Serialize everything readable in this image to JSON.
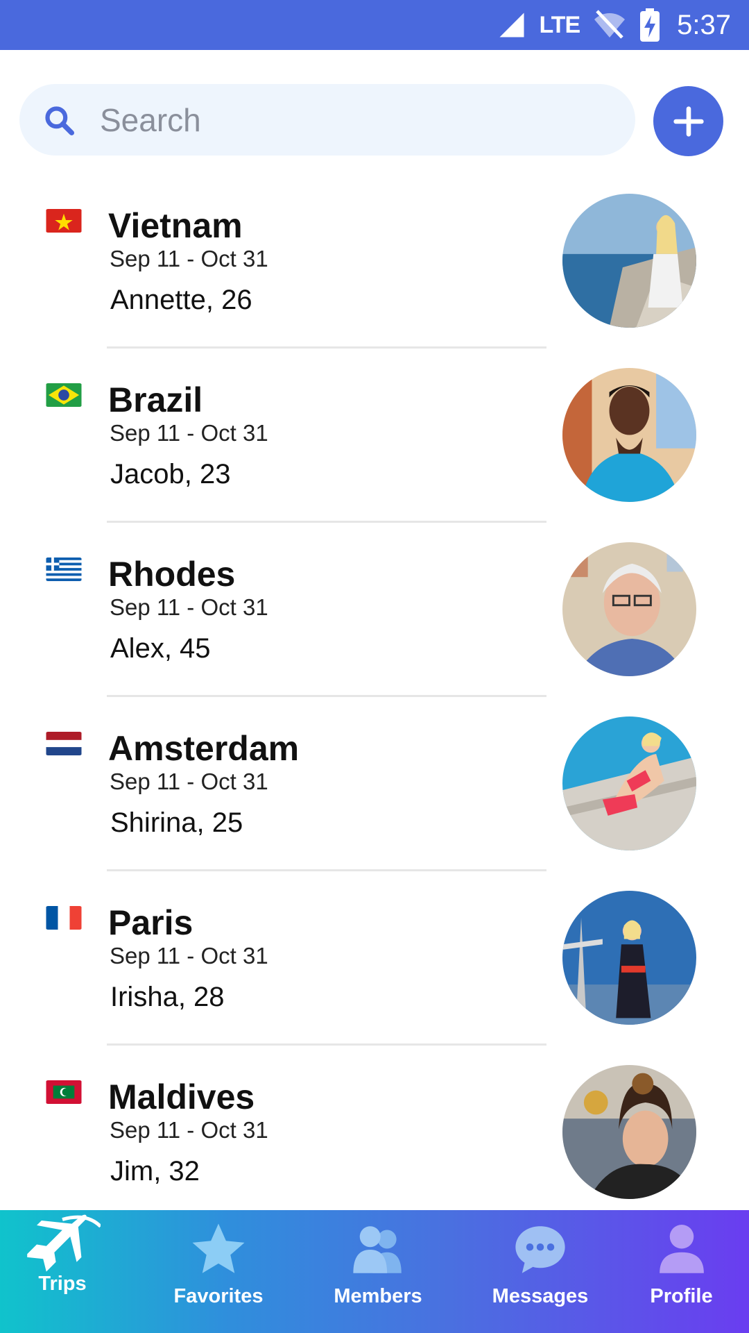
{
  "status_bar": {
    "network": "LTE",
    "time": "5:37"
  },
  "search": {
    "placeholder": "Search"
  },
  "colors": {
    "brand": "#4a69dd",
    "search_bg": "#eef5fd",
    "divider": "#e6e6e6"
  },
  "trips": [
    {
      "flag_icon": "vietnam-flag-icon",
      "destination": "Vietnam",
      "dates": "Sep 11 - Oct 31",
      "member": "Annette, 26"
    },
    {
      "flag_icon": "brazil-flag-icon",
      "destination": "Brazil",
      "dates": "Sep 11 - Oct 31",
      "member": "Jacob, 23"
    },
    {
      "flag_icon": "greece-flag-icon",
      "destination": "Rhodes",
      "dates": "Sep 11 - Oct 31",
      "member": "Alex, 45"
    },
    {
      "flag_icon": "netherlands-flag-icon",
      "destination": "Amsterdam",
      "dates": "Sep 11 - Oct 31",
      "member": "Shirina, 25"
    },
    {
      "flag_icon": "france-flag-icon",
      "destination": "Paris",
      "dates": "Sep 11 - Oct 31",
      "member": "Irisha, 28"
    },
    {
      "flag_icon": "maldives-flag-icon",
      "destination": "Maldives",
      "dates": "Sep 11 - Oct 31",
      "member": "Jim, 32"
    }
  ],
  "nav": {
    "items": [
      {
        "label": "Trips",
        "icon": "plane-icon",
        "active": true
      },
      {
        "label": "Favorites",
        "icon": "star-icon"
      },
      {
        "label": "Members",
        "icon": "members-icon"
      },
      {
        "label": "Messages",
        "icon": "chat-bubble-icon"
      },
      {
        "label": "Profile",
        "icon": "person-icon"
      }
    ]
  }
}
